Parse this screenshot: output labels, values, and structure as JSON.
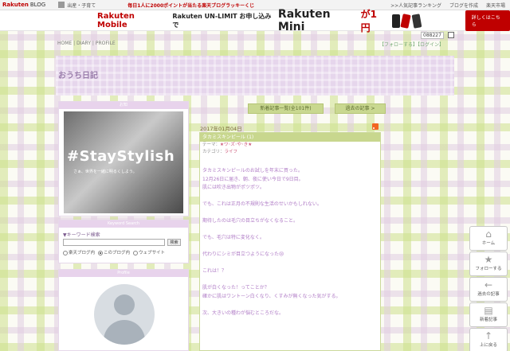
{
  "topbar": {
    "logo": "Rakuten",
    "logo_suffix": "BLOG",
    "category": "出産・子育て",
    "campaign": "毎日1人に2000ポイントが当たる楽天ブログラッキーくじ",
    "links": [
      ">>人気記事ランキング",
      "ブログを作成",
      "楽天市場"
    ]
  },
  "ad": {
    "brand": "Rakuten Mobile",
    "message": "Rakuten UN-LIMIT お申し込みで",
    "product": "Rakuten Mini",
    "price": "が1円",
    "cta": "詳しくはこちら",
    "colors": {
      "brand": "#bf0000"
    }
  },
  "counter": "088227",
  "nav": {
    "home": "HOME",
    "diary": "DIARY",
    "profile": "PROFILE",
    "sep": " | "
  },
  "header_links": {
    "follow": "【フォローする】",
    "login": "【ログイン】"
  },
  "blog_title": "おうち日記",
  "sidebar": {
    "box1_header": "お知",
    "photo_headline": "#StayStylish",
    "photo_caption": "さぁ、世界を一緒に明るくしよう。",
    "search": {
      "header": "Keyword Search",
      "label": "▼キーワード検索",
      "button": "検索",
      "options": [
        "楽天ブログ内",
        "このブログ内",
        "ウェブサイト"
      ],
      "selected": "このブログ内"
    },
    "profile_header": "Profile"
  },
  "main": {
    "btn_new_list": "新着記事一覧(全101件)",
    "btn_prev": "過去の記事 >",
    "date": "2017年01月04日",
    "post": {
      "title": "タカミスキンピール (1)",
      "theme_label": "テーマ：",
      "theme": "★ワ･ズ･や･き★",
      "category_label": "カテゴリ：",
      "category": "ライフ",
      "paragraphs": [
        "タカミスキンピールのお試しを年末に買った。",
        "12月26日に届き、朝、夜に使い今日で9日目。",
        "肌には吹き出物がポツポツ。",
        "",
        "でも、これは正月の不規則な生活のせいかもしれない。",
        "",
        "期待したのは毛穴の目立ちがなくなること。",
        "",
        "でも、毛穴は特に変化なく。",
        "",
        "代わりにシミが目立つようになった😢",
        "",
        "これは！？",
        "",
        "肌が白くなった！ってことか？",
        "確かに肌はワントーン白くなり、くすみが無くなった気がする。",
        "",
        "次、大きいの種わが悩むところだな。"
      ]
    }
  },
  "tools": [
    {
      "icon": "home-icon",
      "label": "ホーム"
    },
    {
      "icon": "star-icon",
      "label": "フォローする"
    },
    {
      "icon": "arrow-left-icon",
      "label": "過去の記事"
    },
    {
      "icon": "list-icon",
      "label": "新着記事"
    },
    {
      "icon": "arrow-up-icon",
      "label": "上に戻る"
    }
  ]
}
